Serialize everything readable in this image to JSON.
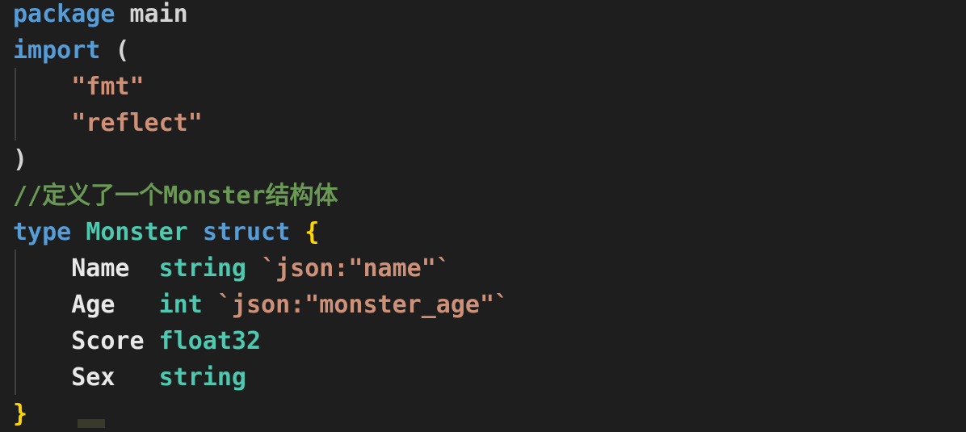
{
  "editor": {
    "language": "go",
    "lines": [
      [
        {
          "t": "package",
          "c": "kw"
        },
        {
          "t": " main",
          "c": "pl"
        }
      ],
      [
        {
          "t": "import",
          "c": "kw"
        },
        {
          "t": " (",
          "c": "pl"
        }
      ],
      [
        {
          "t": "    ",
          "c": "pl"
        },
        {
          "t": "\"fmt\"",
          "c": "str"
        }
      ],
      [
        {
          "t": "    ",
          "c": "pl"
        },
        {
          "t": "\"reflect\"",
          "c": "str"
        }
      ],
      [
        {
          "t": ")",
          "c": "pl"
        }
      ],
      [
        {
          "t": "//定义了一个Monster结构体",
          "c": "cm"
        }
      ],
      [
        {
          "t": "type",
          "c": "kw"
        },
        {
          "t": " ",
          "c": "pl"
        },
        {
          "t": "Monster",
          "c": "ty"
        },
        {
          "t": " ",
          "c": "pl"
        },
        {
          "t": "struct",
          "c": "kw"
        },
        {
          "t": " ",
          "c": "pl"
        },
        {
          "t": "{",
          "c": "brace"
        }
      ],
      [
        {
          "t": "    ",
          "c": "pl"
        },
        {
          "t": "Name",
          "c": "fld"
        },
        {
          "t": "  ",
          "c": "pl"
        },
        {
          "t": "string",
          "c": "ty"
        },
        {
          "t": " ",
          "c": "pl"
        },
        {
          "t": "`json:\"name\"`",
          "c": "str"
        }
      ],
      [
        {
          "t": "    ",
          "c": "pl"
        },
        {
          "t": "Age",
          "c": "fld"
        },
        {
          "t": "   ",
          "c": "pl"
        },
        {
          "t": "int",
          "c": "ty"
        },
        {
          "t": " ",
          "c": "pl"
        },
        {
          "t": "`json:\"monster_age\"`",
          "c": "str"
        }
      ],
      [
        {
          "t": "    ",
          "c": "pl"
        },
        {
          "t": "Score",
          "c": "fld"
        },
        {
          "t": " ",
          "c": "pl"
        },
        {
          "t": "float32",
          "c": "ty"
        }
      ],
      [
        {
          "t": "    ",
          "c": "pl"
        },
        {
          "t": "Sex",
          "c": "fld"
        },
        {
          "t": "   ",
          "c": "pl"
        },
        {
          "t": "string",
          "c": "ty"
        }
      ],
      [
        {
          "t": "}",
          "c": "brace"
        }
      ]
    ]
  },
  "colors": {
    "background": "#1e1e1e",
    "keyword": "#569cd6",
    "string": "#ce9178",
    "comment": "#6a9955",
    "type": "#4ec9b0",
    "text": "#d4d4d4"
  }
}
